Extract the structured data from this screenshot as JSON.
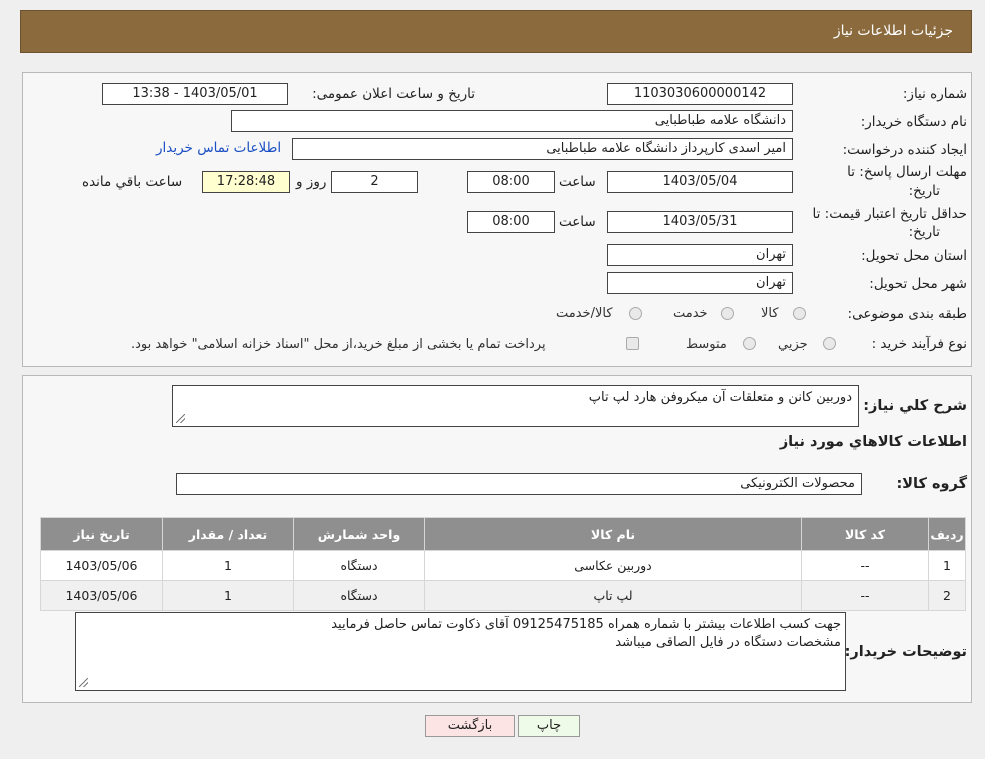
{
  "header": {
    "title": "جزئیات اطلاعات نیاز"
  },
  "form": {
    "need_number_label": "شماره نیاز:",
    "need_number": "1103030600000142",
    "announce_label": "تاریخ و ساعت اعلان عمومی:",
    "announce_value": "1403/05/01 - 13:38",
    "buyer_org_label": "نام دستگاه خریدار:",
    "buyer_org": "دانشگاه علامه طباطبایی",
    "creator_label": "ایجاد کننده درخواست:",
    "creator": "امیر اسدی کارپرداز دانشگاه علامه طباطبایی",
    "contact_link": "اطلاعات تماس خریدار",
    "deadline_label_1": "مهلت ارسال پاسخ: تا",
    "deadline_label_2": "تاریخ:",
    "deadline_date": "1403/05/04",
    "time_label": "ساعت",
    "deadline_time": "08:00",
    "days_value": "2",
    "days_suffix": "روز و",
    "remaining_time": "17:28:48",
    "remaining_suffix": "ساعت باقي مانده",
    "validity_label_1": "حداقل تاریخ اعتبار قیمت: تا",
    "validity_label_2": "تاریخ:",
    "validity_date": "1403/05/31",
    "validity_time": "08:00",
    "province_label": "استان محل تحویل:",
    "province": "تهران",
    "city_label": "شهر محل تحویل:",
    "city": "تهران",
    "category_label": "طبقه بندی موضوعی:",
    "category_options": [
      "کالا",
      "خدمت",
      "کالا/خدمت"
    ],
    "process_label": "نوع فرآیند خرید :",
    "process_options": [
      "جزیي",
      "متوسط"
    ],
    "process_note": "پرداخت تمام یا بخشی از مبلغ خرید،از محل \"اسناد خزانه اسلامی\" خواهد بود."
  },
  "details": {
    "summary_label": "شرح کلي نياز:",
    "summary": "دوربین کانن و متعلقات آن میکروفن هارد لپ تاپ",
    "goods_info_title": "اطلاعات کالاهاي مورد نياز",
    "goods_group_label": "گروه کالا:",
    "goods_group": "محصولات الکترونیکی"
  },
  "table": {
    "headers": [
      "رديف",
      "کد کالا",
      "نام کالا",
      "واحد شمارش",
      "تعداد / مقدار",
      "تاریخ نیاز"
    ],
    "rows": [
      [
        "1",
        "--",
        "دوربین عکاسی",
        "دستگاه",
        "1",
        "1403/05/06"
      ],
      [
        "2",
        "--",
        "لپ تاپ",
        "دستگاه",
        "1",
        "1403/05/06"
      ]
    ]
  },
  "notes": {
    "label": "توضیحات خریدار:",
    "line1": "جهت کسب اطلاعات بیشتر با شماره همراه 09125475185 آقای ذکاوت تماس حاصل فرمایید",
    "line2": "مشخصات دستگاه در فایل الصاقی میباشد"
  },
  "buttons": {
    "print": "چاپ",
    "back": "بازگشت"
  },
  "colors": {
    "header": "#8b6a3e",
    "table_header": "#8f8f8f",
    "link": "#1a4fc4",
    "print_btn": "#eefbe8",
    "back_btn": "#fde4e4"
  }
}
